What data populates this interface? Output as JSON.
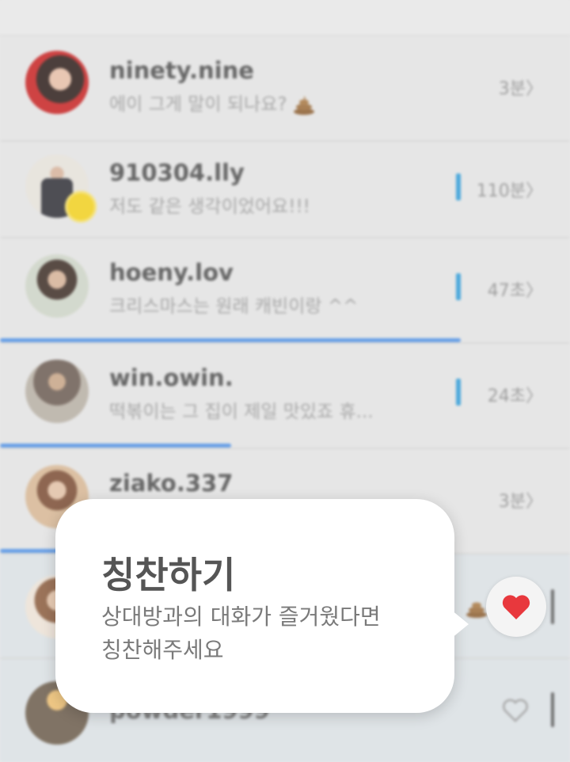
{
  "chats": [
    {
      "name": "ninety.nine",
      "message": "에이 그게 말이 되나요?",
      "time": "3분〉"
    },
    {
      "name": "910304.lly",
      "message": "저도 같은 생각이었어요!!!",
      "time": "110분〉"
    },
    {
      "name": "hoeny.lov",
      "message": "크리스마스는 원래 캐빈이랑 ^^",
      "time": "47초〉"
    },
    {
      "name": "win.owin.",
      "message": "떡볶이는 그 집이 제일 맛있죠 휴...",
      "time": "24초〉"
    },
    {
      "name": "ziako.337",
      "message": "",
      "time": "3분〉"
    },
    {
      "name": "",
      "message": "",
      "time": ""
    },
    {
      "name": "powder1999",
      "message": "",
      "time": ""
    }
  ],
  "progress": [
    {
      "row": 3,
      "fraction": 0.81
    },
    {
      "row": 4,
      "fraction": 0.4
    }
  ],
  "tooltip": {
    "title": "칭찬하기",
    "description_line1": "상대방과의 대화가 즐거웠다면",
    "description_line2": "칭찬해주세요"
  },
  "colors": {
    "accent_blue": "#4a8fe7",
    "unread_bar": "#2b9bd9",
    "heart_red": "#e8383d"
  },
  "icons": {
    "praise": "heart-icon",
    "praise_empty": "heart-outline-icon",
    "emoji": "poop-emoji-icon"
  }
}
